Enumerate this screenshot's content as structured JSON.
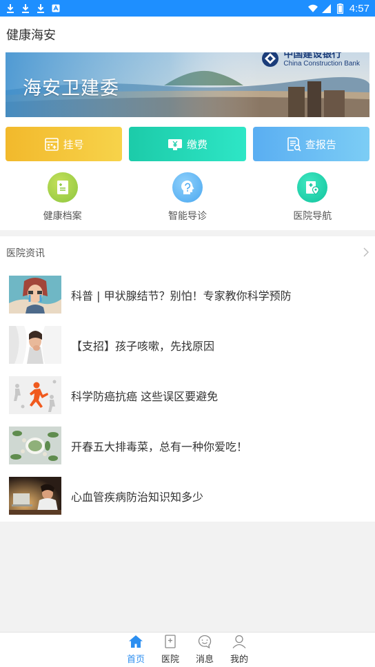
{
  "status_bar": {
    "time": "4:57",
    "icons": [
      "download-icon",
      "download-icon",
      "download-icon",
      "app-icon",
      "wifi-icon",
      "signal-icon",
      "battery-icon"
    ]
  },
  "header": {
    "title": "健康海安"
  },
  "banner": {
    "text": "海安卫建委",
    "bank_name_cn": "中国建设银行",
    "bank_name_en": "China Construction Bank"
  },
  "quick_actions": [
    {
      "label": "挂号",
      "icon": "register-icon",
      "color": "#f2b92c"
    },
    {
      "label": "缴费",
      "icon": "payment-icon",
      "color": "#1ccba9"
    },
    {
      "label": "查报告",
      "icon": "report-icon",
      "color": "#5aaef2"
    }
  ],
  "services": [
    {
      "label": "健康档案",
      "icon": "health-record-icon",
      "color": "#8cc63f"
    },
    {
      "label": "智能导诊",
      "icon": "smart-triage-icon",
      "color": "#4aa8f0"
    },
    {
      "label": "医院导航",
      "icon": "hospital-navigation-icon",
      "color": "#12c39d"
    }
  ],
  "news": {
    "title": "医院资讯",
    "items": [
      {
        "title": "科普 | 甲状腺结节？别怕！专家教你科学预防"
      },
      {
        "title": "【支招】孩子咳嗽，先找原因"
      },
      {
        "title": "科学防癌抗癌 这些误区要避免"
      },
      {
        "title": "开春五大排毒菜，总有一种你爱吃！"
      },
      {
        "title": "心血管疾病防治知识知多少"
      }
    ]
  },
  "tab_bar": {
    "active_color": "#2b8ef0",
    "tabs": [
      {
        "label": "首页",
        "icon": "home-icon",
        "active": true
      },
      {
        "label": "医院",
        "icon": "hospital-icon",
        "active": false
      },
      {
        "label": "消息",
        "icon": "message-icon",
        "active": false
      },
      {
        "label": "我的",
        "icon": "profile-icon",
        "active": false
      }
    ]
  }
}
